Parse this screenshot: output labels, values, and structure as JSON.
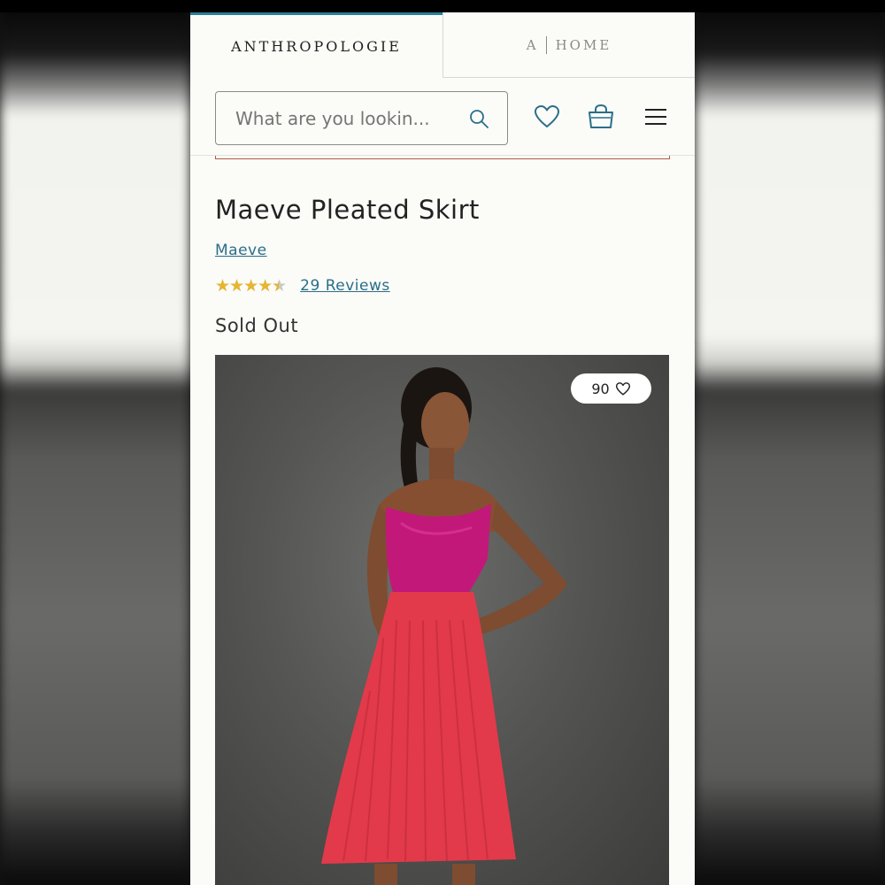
{
  "brand_tabs": {
    "primary": "ANTHROPOLOGIE",
    "secondary_mark": "A",
    "secondary": "HOME"
  },
  "header": {
    "search_placeholder": "What are you lookin...",
    "icons": [
      "search-icon",
      "heart-icon",
      "shopping-bag-icon",
      "menu-icon"
    ]
  },
  "product": {
    "title": "Maeve Pleated Skirt",
    "brand": "Maeve",
    "rating": 4.5,
    "rating_max": 5,
    "reviews": "29 Reviews",
    "status": "Sold Out",
    "favorites": "90"
  },
  "colors": {
    "accent": "#2a6f89",
    "tab_indicator": "#2a7f99",
    "star": "#e7b52f",
    "top": "#c2187a",
    "skirt": "#e23a4a"
  }
}
